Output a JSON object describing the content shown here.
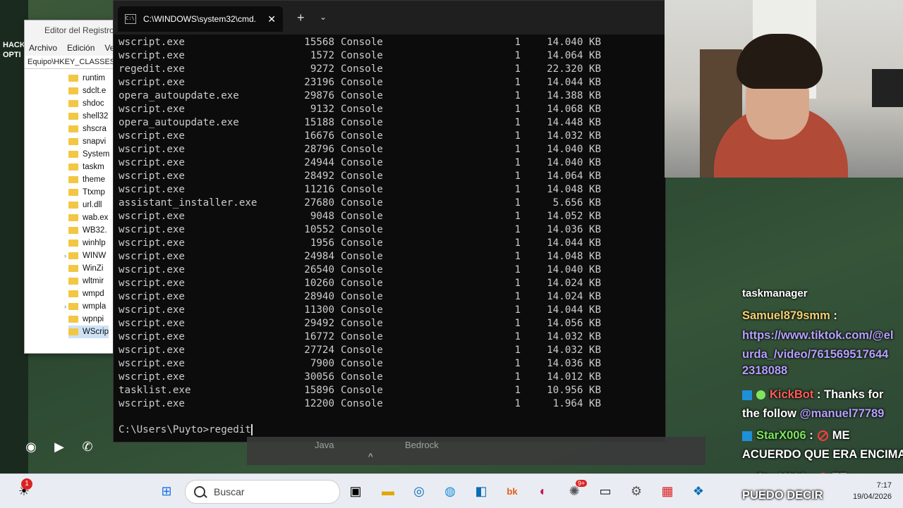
{
  "desktop": {
    "left_text_1": "HACK",
    "left_text_2": "OPTI"
  },
  "regedit": {
    "title": "Editor del Registro",
    "menu": [
      "Archivo",
      "Edición",
      "Ve"
    ],
    "address": "Equipo\\HKEY_CLASSES",
    "items": [
      "runtim",
      "sdclt.e",
      "shdoc",
      "shell32",
      "shscra",
      "snapvi",
      "System",
      "taskm",
      "theme",
      "Ttxmp",
      "url.dll",
      "wab.ex",
      "WB32.",
      "winhlp",
      "WINW",
      "WinZi",
      "wltmir",
      "wmpd",
      "wmpla",
      "wpnpi",
      "WScrip"
    ]
  },
  "cmd": {
    "tab_title": "C:\\WINDOWS\\system32\\cmd.",
    "close": "✕",
    "new_tab": "+",
    "dropdown": "⌄",
    "rows": [
      {
        "name": "wscript.exe",
        "pid": "15568",
        "session": "Console",
        "num": "1",
        "mem": "14.040 KB"
      },
      {
        "name": "wscript.exe",
        "pid": "1572",
        "session": "Console",
        "num": "1",
        "mem": "14.064 KB"
      },
      {
        "name": "regedit.exe",
        "pid": "9272",
        "session": "Console",
        "num": "1",
        "mem": "22.320 KB"
      },
      {
        "name": "wscript.exe",
        "pid": "23196",
        "session": "Console",
        "num": "1",
        "mem": "14.044 KB"
      },
      {
        "name": "opera_autoupdate.exe",
        "pid": "29876",
        "session": "Console",
        "num": "1",
        "mem": "14.388 KB"
      },
      {
        "name": "wscript.exe",
        "pid": "9132",
        "session": "Console",
        "num": "1",
        "mem": "14.068 KB"
      },
      {
        "name": "opera_autoupdate.exe",
        "pid": "15188",
        "session": "Console",
        "num": "1",
        "mem": "14.448 KB"
      },
      {
        "name": "wscript.exe",
        "pid": "16676",
        "session": "Console",
        "num": "1",
        "mem": "14.032 KB"
      },
      {
        "name": "wscript.exe",
        "pid": "28796",
        "session": "Console",
        "num": "1",
        "mem": "14.040 KB"
      },
      {
        "name": "wscript.exe",
        "pid": "24944",
        "session": "Console",
        "num": "1",
        "mem": "14.040 KB"
      },
      {
        "name": "wscript.exe",
        "pid": "28492",
        "session": "Console",
        "num": "1",
        "mem": "14.064 KB"
      },
      {
        "name": "wscript.exe",
        "pid": "11216",
        "session": "Console",
        "num": "1",
        "mem": "14.048 KB"
      },
      {
        "name": "assistant_installer.exe",
        "pid": "27680",
        "session": "Console",
        "num": "1",
        "mem": "5.656 KB"
      },
      {
        "name": "wscript.exe",
        "pid": "9048",
        "session": "Console",
        "num": "1",
        "mem": "14.052 KB"
      },
      {
        "name": "wscript.exe",
        "pid": "10552",
        "session": "Console",
        "num": "1",
        "mem": "14.036 KB"
      },
      {
        "name": "wscript.exe",
        "pid": "1956",
        "session": "Console",
        "num": "1",
        "mem": "14.044 KB"
      },
      {
        "name": "wscript.exe",
        "pid": "24984",
        "session": "Console",
        "num": "1",
        "mem": "14.048 KB"
      },
      {
        "name": "wscript.exe",
        "pid": "26540",
        "session": "Console",
        "num": "1",
        "mem": "14.040 KB"
      },
      {
        "name": "wscript.exe",
        "pid": "10260",
        "session": "Console",
        "num": "1",
        "mem": "14.024 KB"
      },
      {
        "name": "wscript.exe",
        "pid": "28940",
        "session": "Console",
        "num": "1",
        "mem": "14.024 KB"
      },
      {
        "name": "wscript.exe",
        "pid": "11300",
        "session": "Console",
        "num": "1",
        "mem": "14.044 KB"
      },
      {
        "name": "wscript.exe",
        "pid": "29492",
        "session": "Console",
        "num": "1",
        "mem": "14.056 KB"
      },
      {
        "name": "wscript.exe",
        "pid": "16772",
        "session": "Console",
        "num": "1",
        "mem": "14.032 KB"
      },
      {
        "name": "wscript.exe",
        "pid": "27724",
        "session": "Console",
        "num": "1",
        "mem": "14.032 KB"
      },
      {
        "name": "wscript.exe",
        "pid": "7900",
        "session": "Console",
        "num": "1",
        "mem": "14.036 KB"
      },
      {
        "name": "wscript.exe",
        "pid": "30056",
        "session": "Console",
        "num": "1",
        "mem": "14.012 KB"
      },
      {
        "name": "tasklist.exe",
        "pid": "15896",
        "session": "Console",
        "num": "1",
        "mem": "10.956 KB"
      },
      {
        "name": "wscript.exe",
        "pid": "12200",
        "session": "Console",
        "num": "1",
        "mem": "1.964 KB"
      }
    ],
    "prompt": "C:\\Users\\Puyto>regedit"
  },
  "chat": {
    "line1": "taskmanager",
    "user1": "Samuel879smm",
    "colon": " :",
    "link1": "https://www.tiktok.com/@el",
    "link2": "urda_/video/761569517644",
    "link3": "2318088",
    "user2": "KickBot",
    "msg2a": " : Thanks for",
    "msg2b": "the follow ",
    "mention2": "@manuel77789",
    "user3": "StarX006",
    "msg3a": "ME",
    "msg3b": "ACUERDO QUE ERA ENCIMA",
    "msg4a": "TE",
    "msg4b": "PUEDO DECIR"
  },
  "launcher": {
    "java": "Java",
    "bedrock": "Bedrock",
    "caret": "^"
  },
  "taskbar": {
    "search_placeholder": "Buscar",
    "time": "7:17",
    "date": "19/04/2026",
    "notif_count": "1",
    "badge_count": "9+"
  }
}
